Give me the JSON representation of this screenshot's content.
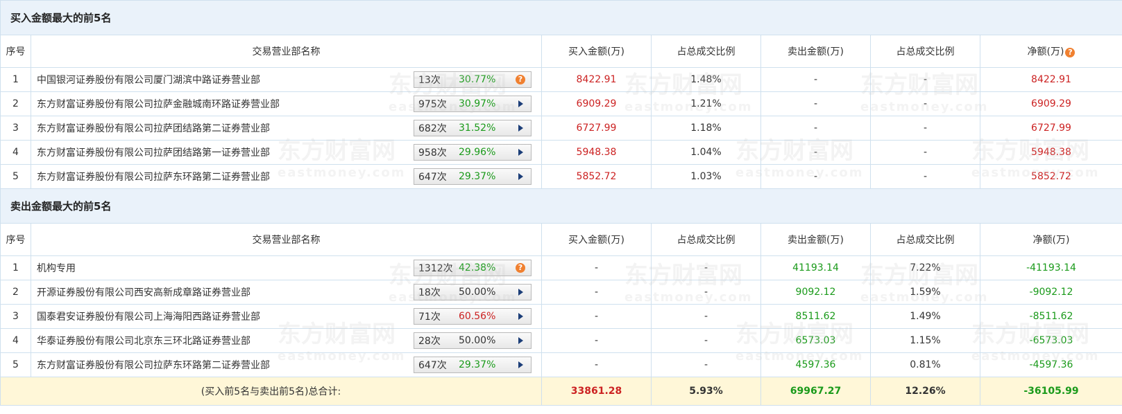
{
  "buy_section": {
    "title": "买入金额最大的前5名",
    "headers": [
      "序号",
      "交易营业部名称",
      "买入金额(万)",
      "占总成交比例",
      "卖出金额(万)",
      "占总成交比例",
      "净额(万)"
    ],
    "rows": [
      {
        "idx": "1",
        "name": "中国银河证券股份有限公司厦门湖滨中路证券营业部",
        "count": "13次",
        "pct": "30.77%",
        "pct_color": "green",
        "icon": "question-icon",
        "buy": "8422.91",
        "buy_ratio": "1.48%",
        "sell": "-",
        "sell_ratio": "-",
        "net": "8422.91"
      },
      {
        "idx": "2",
        "name": "东方财富证券股份有限公司拉萨金融城南环路证券营业部",
        "count": "975次",
        "pct": "30.97%",
        "pct_color": "green",
        "icon": "arrow-icon",
        "buy": "6909.29",
        "buy_ratio": "1.21%",
        "sell": "-",
        "sell_ratio": "-",
        "net": "6909.29"
      },
      {
        "idx": "3",
        "name": "东方财富证券股份有限公司拉萨团结路第二证券营业部",
        "count": "682次",
        "pct": "31.52%",
        "pct_color": "green",
        "icon": "arrow-icon",
        "buy": "6727.99",
        "buy_ratio": "1.18%",
        "sell": "-",
        "sell_ratio": "-",
        "net": "6727.99"
      },
      {
        "idx": "4",
        "name": "东方财富证券股份有限公司拉萨团结路第一证券营业部",
        "count": "958次",
        "pct": "29.96%",
        "pct_color": "green",
        "icon": "arrow-icon",
        "buy": "5948.38",
        "buy_ratio": "1.04%",
        "sell": "-",
        "sell_ratio": "-",
        "net": "5948.38"
      },
      {
        "idx": "5",
        "name": "东方财富证券股份有限公司拉萨东环路第二证券营业部",
        "count": "647次",
        "pct": "29.37%",
        "pct_color": "green",
        "icon": "arrow-icon",
        "buy": "5852.72",
        "buy_ratio": "1.03%",
        "sell": "-",
        "sell_ratio": "-",
        "net": "5852.72"
      }
    ]
  },
  "sell_section": {
    "title": "卖出金额最大的前5名",
    "headers": [
      "序号",
      "交易营业部名称",
      "买入金额(万)",
      "占总成交比例",
      "卖出金额(万)",
      "占总成交比例",
      "净额(万)"
    ],
    "rows": [
      {
        "idx": "1",
        "name": "机构专用",
        "count": "1312次",
        "pct": "42.38%",
        "pct_color": "green",
        "icon": "question-icon",
        "buy": "-",
        "buy_ratio": "-",
        "sell": "41193.14",
        "sell_ratio": "7.22%",
        "net": "-41193.14"
      },
      {
        "idx": "2",
        "name": "开源证券股份有限公司西安高新成章路证券营业部",
        "count": "18次",
        "pct": "50.00%",
        "pct_color": "dark",
        "icon": "arrow-icon",
        "buy": "-",
        "buy_ratio": "-",
        "sell": "9092.12",
        "sell_ratio": "1.59%",
        "net": "-9092.12"
      },
      {
        "idx": "3",
        "name": "国泰君安证券股份有限公司上海海阳西路证券营业部",
        "count": "71次",
        "pct": "60.56%",
        "pct_color": "red",
        "icon": "arrow-icon",
        "buy": "-",
        "buy_ratio": "-",
        "sell": "8511.62",
        "sell_ratio": "1.49%",
        "net": "-8511.62"
      },
      {
        "idx": "4",
        "name": "华泰证券股份有限公司北京东三环北路证券营业部",
        "count": "28次",
        "pct": "50.00%",
        "pct_color": "dark",
        "icon": "arrow-icon",
        "buy": "-",
        "buy_ratio": "-",
        "sell": "6573.03",
        "sell_ratio": "1.15%",
        "net": "-6573.03"
      },
      {
        "idx": "5",
        "name": "东方财富证券股份有限公司拉萨东环路第二证券营业部",
        "count": "647次",
        "pct": "29.37%",
        "pct_color": "green",
        "icon": "arrow-icon",
        "buy": "-",
        "buy_ratio": "-",
        "sell": "4597.36",
        "sell_ratio": "0.81%",
        "net": "-4597.36"
      }
    ]
  },
  "total": {
    "label": "(买入前5名与卖出前5名)总合计:",
    "buy": "33861.28",
    "buy_ratio": "5.93%",
    "sell": "69967.27",
    "sell_ratio": "12.26%",
    "net": "-36105.99"
  },
  "watermark": {
    "brand": "东方财富网",
    "domain": "eastmoney.com"
  },
  "colors": {
    "green": "#1a9a1a",
    "red": "#cc2222",
    "section_bg": "#eaf2fa",
    "total_bg": "#fff7d8"
  }
}
